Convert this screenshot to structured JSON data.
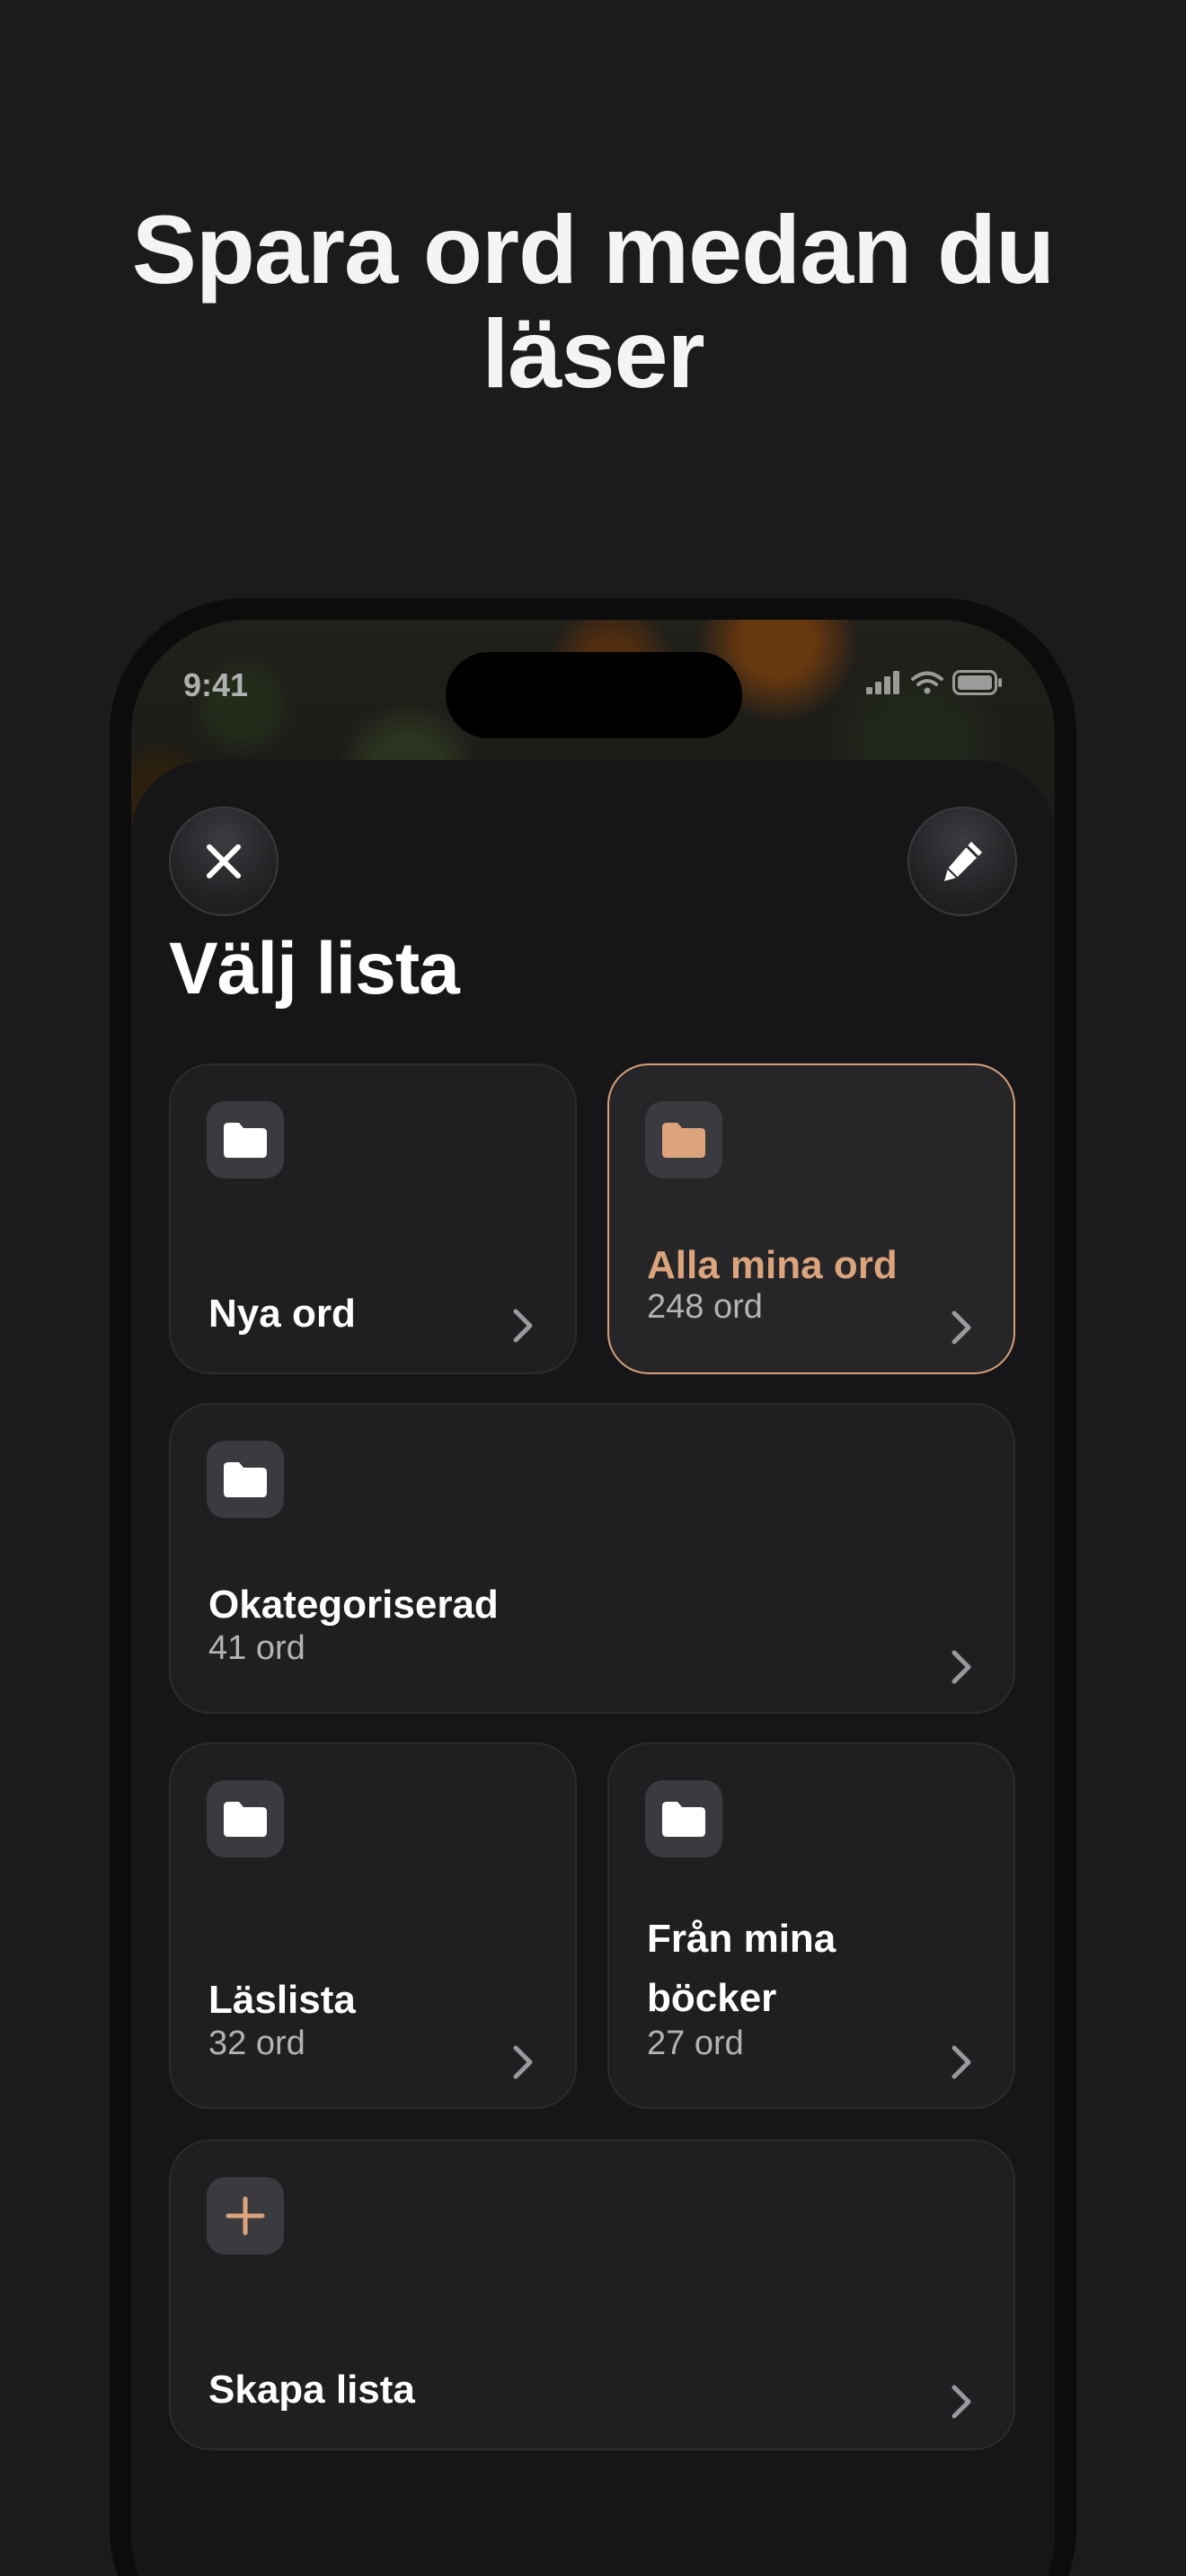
{
  "headline": "Spara ord medan du läser",
  "status_bar": {
    "time": "9:41"
  },
  "sheet": {
    "title": "Välj lista",
    "close_icon": "close-icon",
    "edit_icon": "pencil-icon"
  },
  "lists": [
    {
      "name": "Nya ord",
      "count": "",
      "icon": "folder-icon",
      "selected": false
    },
    {
      "name": "Alla mina ord",
      "count": "248 ord",
      "icon": "folder-icon",
      "selected": true
    },
    {
      "name": "Okategoriserad",
      "count": "41 ord",
      "icon": "folder-icon",
      "selected": false
    },
    {
      "name": "Läslista",
      "count": "32 ord",
      "icon": "folder-icon",
      "selected": false
    },
    {
      "name": "Från mina böcker",
      "count": "27 ord",
      "icon": "folder-icon",
      "selected": false
    }
  ],
  "create_list": {
    "label": "Skapa lista",
    "icon": "plus-icon"
  },
  "colors": {
    "background": "#1b1b1d",
    "card": "#1f1f22",
    "accent": "#dca47c"
  }
}
